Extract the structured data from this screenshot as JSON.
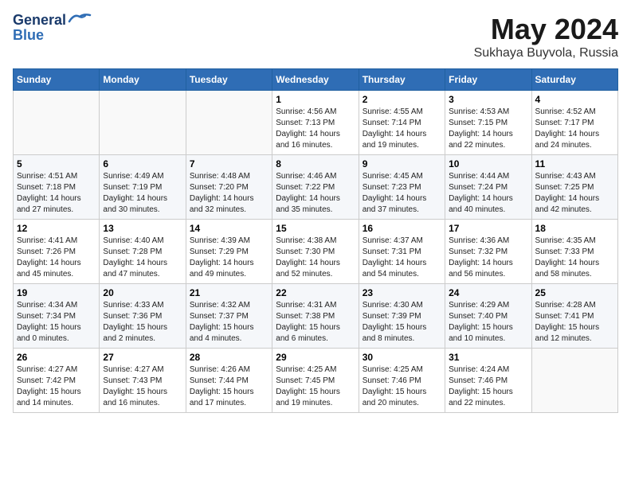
{
  "logo": {
    "text_general": "General",
    "text_blue": "Blue"
  },
  "title": {
    "month_year": "May 2024",
    "location": "Sukhaya Buyvola, Russia"
  },
  "days_of_week": [
    "Sunday",
    "Monday",
    "Tuesday",
    "Wednesday",
    "Thursday",
    "Friday",
    "Saturday"
  ],
  "weeks": [
    [
      {
        "day": "",
        "sunrise": "",
        "sunset": "",
        "daylight": ""
      },
      {
        "day": "",
        "sunrise": "",
        "sunset": "",
        "daylight": ""
      },
      {
        "day": "",
        "sunrise": "",
        "sunset": "",
        "daylight": ""
      },
      {
        "day": "1",
        "sunrise": "Sunrise: 4:56 AM",
        "sunset": "Sunset: 7:13 PM",
        "daylight": "Daylight: 14 hours and 16 minutes."
      },
      {
        "day": "2",
        "sunrise": "Sunrise: 4:55 AM",
        "sunset": "Sunset: 7:14 PM",
        "daylight": "Daylight: 14 hours and 19 minutes."
      },
      {
        "day": "3",
        "sunrise": "Sunrise: 4:53 AM",
        "sunset": "Sunset: 7:15 PM",
        "daylight": "Daylight: 14 hours and 22 minutes."
      },
      {
        "day": "4",
        "sunrise": "Sunrise: 4:52 AM",
        "sunset": "Sunset: 7:17 PM",
        "daylight": "Daylight: 14 hours and 24 minutes."
      }
    ],
    [
      {
        "day": "5",
        "sunrise": "Sunrise: 4:51 AM",
        "sunset": "Sunset: 7:18 PM",
        "daylight": "Daylight: 14 hours and 27 minutes."
      },
      {
        "day": "6",
        "sunrise": "Sunrise: 4:49 AM",
        "sunset": "Sunset: 7:19 PM",
        "daylight": "Daylight: 14 hours and 30 minutes."
      },
      {
        "day": "7",
        "sunrise": "Sunrise: 4:48 AM",
        "sunset": "Sunset: 7:20 PM",
        "daylight": "Daylight: 14 hours and 32 minutes."
      },
      {
        "day": "8",
        "sunrise": "Sunrise: 4:46 AM",
        "sunset": "Sunset: 7:22 PM",
        "daylight": "Daylight: 14 hours and 35 minutes."
      },
      {
        "day": "9",
        "sunrise": "Sunrise: 4:45 AM",
        "sunset": "Sunset: 7:23 PM",
        "daylight": "Daylight: 14 hours and 37 minutes."
      },
      {
        "day": "10",
        "sunrise": "Sunrise: 4:44 AM",
        "sunset": "Sunset: 7:24 PM",
        "daylight": "Daylight: 14 hours and 40 minutes."
      },
      {
        "day": "11",
        "sunrise": "Sunrise: 4:43 AM",
        "sunset": "Sunset: 7:25 PM",
        "daylight": "Daylight: 14 hours and 42 minutes."
      }
    ],
    [
      {
        "day": "12",
        "sunrise": "Sunrise: 4:41 AM",
        "sunset": "Sunset: 7:26 PM",
        "daylight": "Daylight: 14 hours and 45 minutes."
      },
      {
        "day": "13",
        "sunrise": "Sunrise: 4:40 AM",
        "sunset": "Sunset: 7:28 PM",
        "daylight": "Daylight: 14 hours and 47 minutes."
      },
      {
        "day": "14",
        "sunrise": "Sunrise: 4:39 AM",
        "sunset": "Sunset: 7:29 PM",
        "daylight": "Daylight: 14 hours and 49 minutes."
      },
      {
        "day": "15",
        "sunrise": "Sunrise: 4:38 AM",
        "sunset": "Sunset: 7:30 PM",
        "daylight": "Daylight: 14 hours and 52 minutes."
      },
      {
        "day": "16",
        "sunrise": "Sunrise: 4:37 AM",
        "sunset": "Sunset: 7:31 PM",
        "daylight": "Daylight: 14 hours and 54 minutes."
      },
      {
        "day": "17",
        "sunrise": "Sunrise: 4:36 AM",
        "sunset": "Sunset: 7:32 PM",
        "daylight": "Daylight: 14 hours and 56 minutes."
      },
      {
        "day": "18",
        "sunrise": "Sunrise: 4:35 AM",
        "sunset": "Sunset: 7:33 PM",
        "daylight": "Daylight: 14 hours and 58 minutes."
      }
    ],
    [
      {
        "day": "19",
        "sunrise": "Sunrise: 4:34 AM",
        "sunset": "Sunset: 7:34 PM",
        "daylight": "Daylight: 15 hours and 0 minutes."
      },
      {
        "day": "20",
        "sunrise": "Sunrise: 4:33 AM",
        "sunset": "Sunset: 7:36 PM",
        "daylight": "Daylight: 15 hours and 2 minutes."
      },
      {
        "day": "21",
        "sunrise": "Sunrise: 4:32 AM",
        "sunset": "Sunset: 7:37 PM",
        "daylight": "Daylight: 15 hours and 4 minutes."
      },
      {
        "day": "22",
        "sunrise": "Sunrise: 4:31 AM",
        "sunset": "Sunset: 7:38 PM",
        "daylight": "Daylight: 15 hours and 6 minutes."
      },
      {
        "day": "23",
        "sunrise": "Sunrise: 4:30 AM",
        "sunset": "Sunset: 7:39 PM",
        "daylight": "Daylight: 15 hours and 8 minutes."
      },
      {
        "day": "24",
        "sunrise": "Sunrise: 4:29 AM",
        "sunset": "Sunset: 7:40 PM",
        "daylight": "Daylight: 15 hours and 10 minutes."
      },
      {
        "day": "25",
        "sunrise": "Sunrise: 4:28 AM",
        "sunset": "Sunset: 7:41 PM",
        "daylight": "Daylight: 15 hours and 12 minutes."
      }
    ],
    [
      {
        "day": "26",
        "sunrise": "Sunrise: 4:27 AM",
        "sunset": "Sunset: 7:42 PM",
        "daylight": "Daylight: 15 hours and 14 minutes."
      },
      {
        "day": "27",
        "sunrise": "Sunrise: 4:27 AM",
        "sunset": "Sunset: 7:43 PM",
        "daylight": "Daylight: 15 hours and 16 minutes."
      },
      {
        "day": "28",
        "sunrise": "Sunrise: 4:26 AM",
        "sunset": "Sunset: 7:44 PM",
        "daylight": "Daylight: 15 hours and 17 minutes."
      },
      {
        "day": "29",
        "sunrise": "Sunrise: 4:25 AM",
        "sunset": "Sunset: 7:45 PM",
        "daylight": "Daylight: 15 hours and 19 minutes."
      },
      {
        "day": "30",
        "sunrise": "Sunrise: 4:25 AM",
        "sunset": "Sunset: 7:46 PM",
        "daylight": "Daylight: 15 hours and 20 minutes."
      },
      {
        "day": "31",
        "sunrise": "Sunrise: 4:24 AM",
        "sunset": "Sunset: 7:46 PM",
        "daylight": "Daylight: 15 hours and 22 minutes."
      },
      {
        "day": "",
        "sunrise": "",
        "sunset": "",
        "daylight": ""
      }
    ]
  ]
}
